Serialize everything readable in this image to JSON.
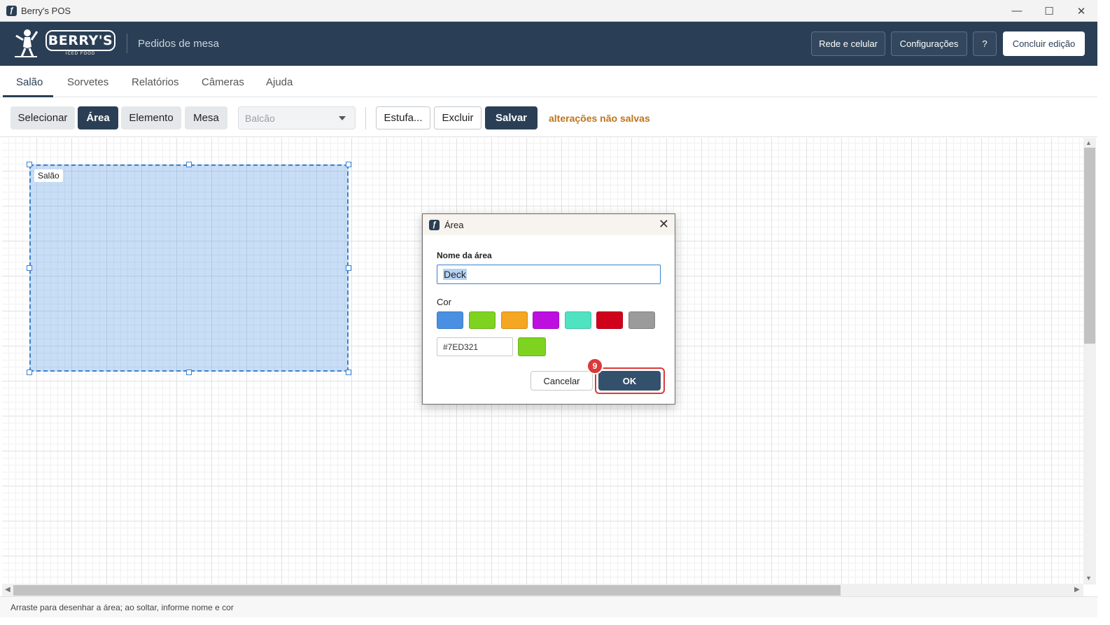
{
  "window": {
    "title": "Berry's POS",
    "app_icon": "berrys-app-icon",
    "controls": [
      "minimize-icon",
      "maximize-icon",
      "close-icon"
    ],
    "minimize_glyph": "—",
    "maximize_glyph": "☐",
    "close_glyph": "✕"
  },
  "header": {
    "logo_text": "BERRY'S",
    "logo_subtext": "ICED FOOD",
    "subtitle": "Pedidos de mesa",
    "buttons": {
      "network": "Rede e celular",
      "settings": "Configurações",
      "help": "?",
      "finish_edit": "Concluir edição"
    },
    "colors": {
      "background": "#2a3f55"
    }
  },
  "tabs": {
    "items": [
      "Salão",
      "Sorvetes",
      "Relatórios",
      "Câmeras",
      "Ajuda"
    ],
    "active": "Salão"
  },
  "toolbar": {
    "select": "Selecionar",
    "area": "Área",
    "element": "Elemento",
    "table": "Mesa",
    "area_dropdown_value": "Balcão",
    "stretch": "Estufa...",
    "delete": "Excluir",
    "save": "Salvar",
    "unsaved_notice": "alterações não salvas",
    "colors": {
      "unsaved": "#c0731a"
    }
  },
  "canvas": {
    "area_label": "Salão",
    "area_color": "#4A90E2"
  },
  "dialog": {
    "title": "Área",
    "name_label": "Nome da área",
    "name_value": "Deck",
    "color_label": "Cor",
    "swatches": [
      "#4A90E2",
      "#7ED321",
      "#F5A623",
      "#BD10E0",
      "#50E3C2",
      "#D0021B",
      "#9B9B9B"
    ],
    "hex_value": "#7ED321",
    "preview_color": "#7ED321",
    "cancel": "Cancelar",
    "ok": "OK",
    "step_badge": "9"
  },
  "statusbar": {
    "text": "Arraste para desenhar a área; ao soltar, informe nome e cor"
  }
}
